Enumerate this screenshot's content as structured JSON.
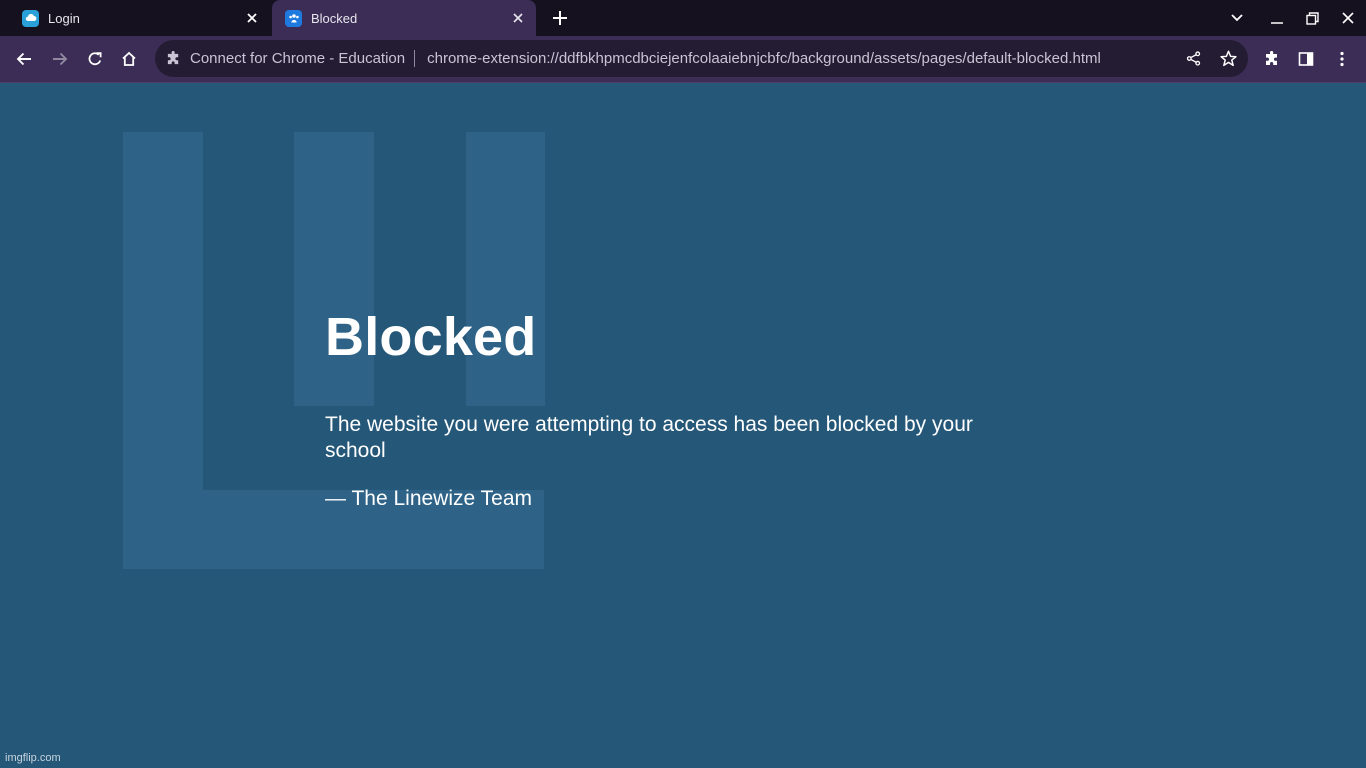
{
  "browser": {
    "tabs": [
      {
        "title": "Login",
        "favicon": "cloud-icon",
        "active": false
      },
      {
        "title": "Blocked",
        "favicon": "people-icon",
        "active": true
      }
    ],
    "omnibox": {
      "site_name": "Connect for Chrome - Education",
      "url": "chrome-extension://ddfbkhpmcdbciejenfcolaaiebnjcbfc/background/assets/pages/default-blocked.html"
    }
  },
  "page": {
    "title": "Blocked",
    "message": "The website you were attempting to access has been blocked by your school",
    "signature": "— The Linewize Team"
  },
  "watermark": "imgflip.com",
  "colors": {
    "tabstrip": "#15111f",
    "toolbar": "#3b2d55",
    "omnibox": "#241c33",
    "page_background": "#255778",
    "logo_shape": "#2e6387"
  }
}
